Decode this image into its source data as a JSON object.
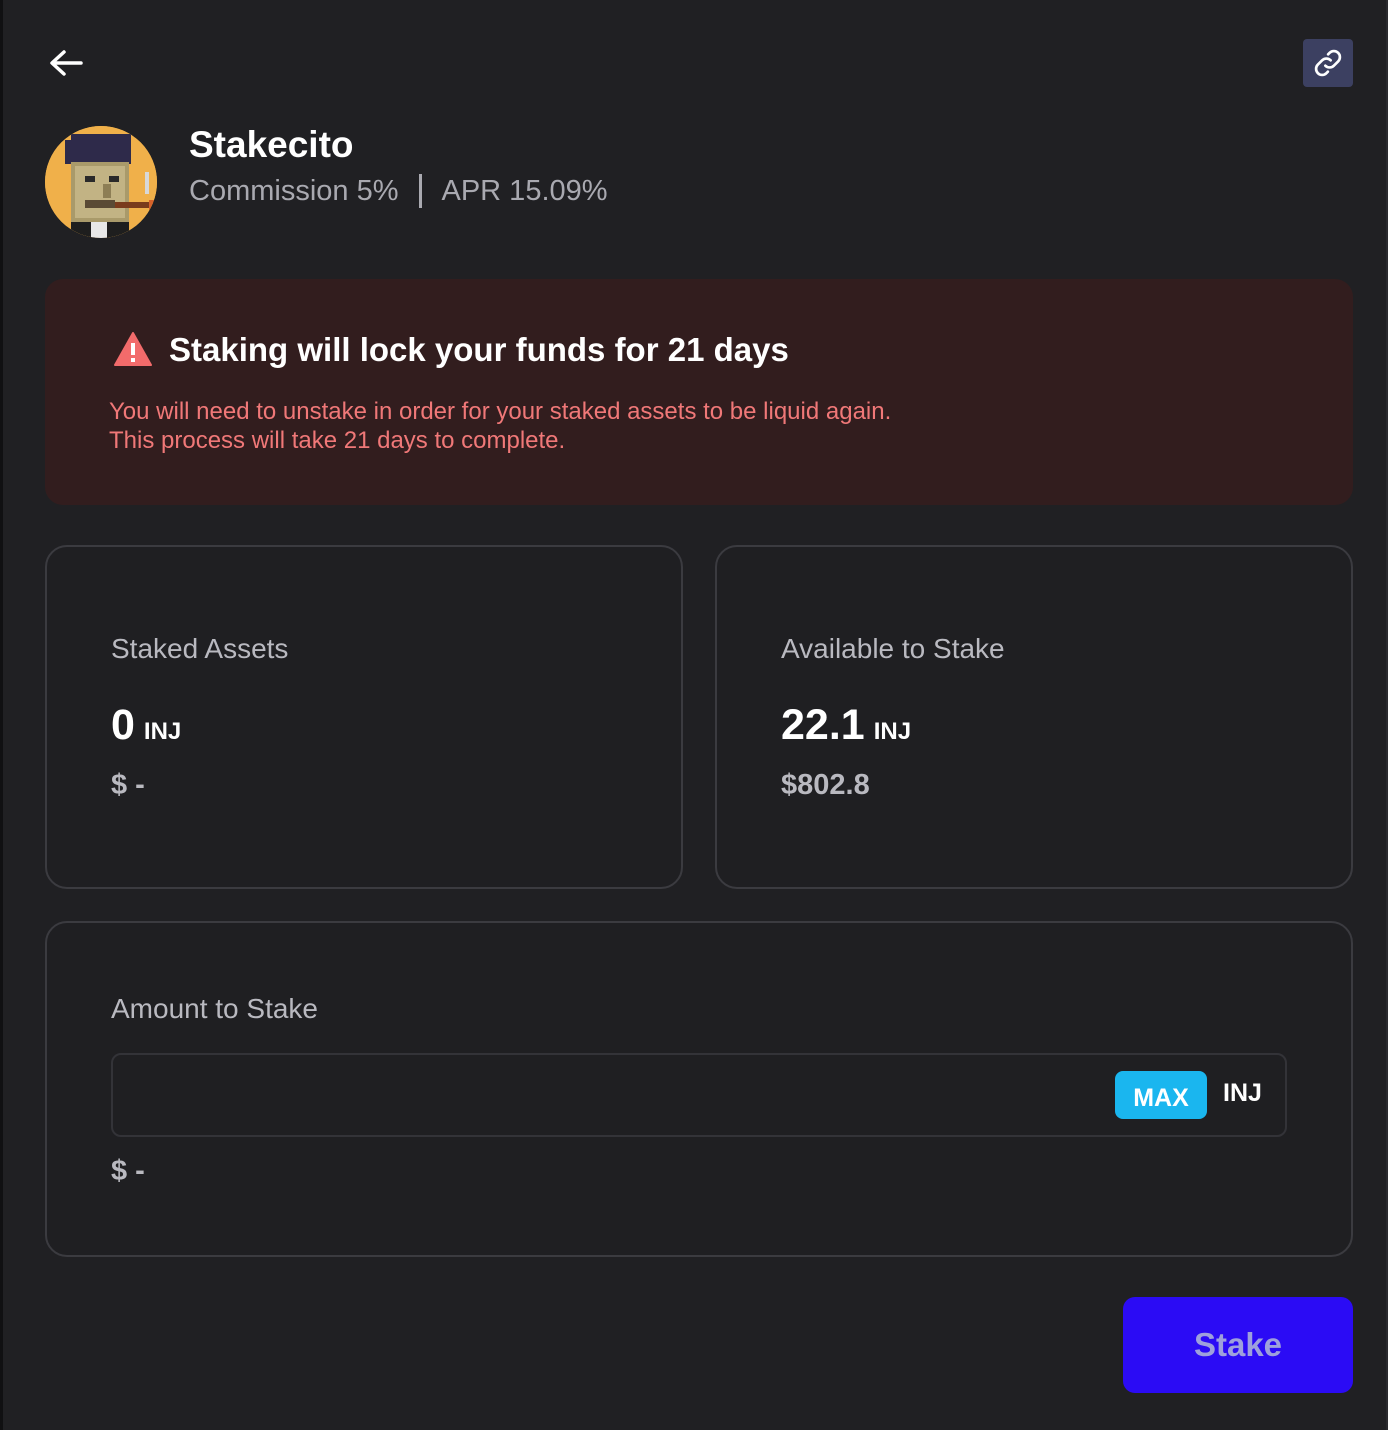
{
  "validator": {
    "name": "Stakecito",
    "commission": "Commission 5%",
    "apr": "APR 15.09%"
  },
  "warning": {
    "title": "Staking will lock your funds for 21 days",
    "line1": "You will need to unstake in order for your staked assets to be liquid again.",
    "line2": "This process will take 21 days to complete."
  },
  "staked": {
    "label": "Staked Assets",
    "amount": "0",
    "unit": "INJ",
    "usd": "$ -"
  },
  "available": {
    "label": "Available to Stake",
    "amount": "22.1",
    "unit": "INJ",
    "usd": "$802.8"
  },
  "stake_form": {
    "label": "Amount to Stake",
    "input_value": "",
    "max_label": "MAX",
    "unit": "INJ",
    "usd": "$ -"
  },
  "actions": {
    "stake_label": "Stake"
  },
  "icons": {
    "back": "arrow-left-icon",
    "link": "link-icon",
    "warning": "warning-triangle-icon"
  },
  "colors": {
    "accent_button": "#2b0bf5",
    "max_button": "#1ab6ef",
    "warning_bg": "#321d1e",
    "warning_text": "#f07878",
    "link_button": "#3c4061"
  }
}
